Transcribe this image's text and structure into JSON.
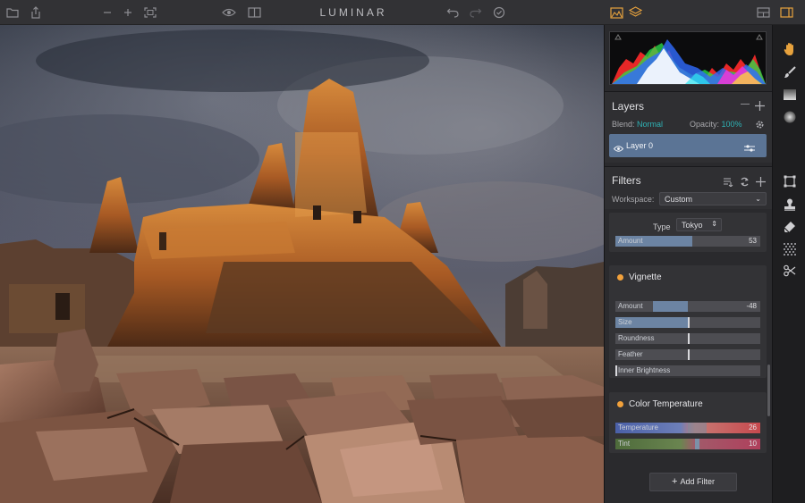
{
  "app": {
    "title": "LUMINAR"
  },
  "toolbar": {
    "icons": [
      "folder-icon",
      "share-icon",
      "zoom-out-icon",
      "zoom-in-icon",
      "fit-screen-icon",
      "preview-eye-icon",
      "compare-icon",
      "undo-icon",
      "redo-icon",
      "apply-check-icon",
      "histogram-toggle-icon",
      "layers-toggle-icon",
      "layout-icon",
      "side-panel-icon"
    ]
  },
  "histogram": {
    "colors": [
      "#ff2a2a",
      "#29e04a",
      "#2f6bff",
      "#ffffff",
      "#ff31d5",
      "#ffe62b",
      "#2ce6f0"
    ]
  },
  "layers": {
    "title": "Layers",
    "blend_label": "Blend:",
    "blend_value": "Normal",
    "opacity_label": "Opacity:",
    "opacity_value": "100%",
    "items": [
      {
        "name": "Layer 0"
      }
    ]
  },
  "filters": {
    "title": "Filters",
    "workspace_label": "Workspace:",
    "workspace_value": "Custom",
    "add_filter_label": "Add Filter",
    "partial": {
      "type_label": "Type",
      "type_value": "Tokyo",
      "amount": {
        "label": "Amount",
        "value": 53,
        "display": "53"
      }
    },
    "vignette": {
      "name": "Vignette",
      "sliders": [
        {
          "label": "Amount",
          "display": "-48",
          "value": -48,
          "fill_start": 0.26,
          "fill_end": 0.5
        },
        {
          "label": "Size",
          "display": "",
          "value": 50,
          "fill_start": 0,
          "fill_end": 0.5
        },
        {
          "label": "Roundness",
          "display": "",
          "value": 0,
          "fill_start": 0.5,
          "fill_end": 0.5
        },
        {
          "label": "Feather",
          "display": "",
          "value": 0,
          "fill_start": 0.5,
          "fill_end": 0.5
        },
        {
          "label": "Inner Brightness",
          "display": "",
          "value": 0,
          "fill_start": 0,
          "fill_end": 0
        }
      ]
    },
    "color_temperature": {
      "name": "Color Temperature",
      "temperature": {
        "label": "Temperature",
        "value": 26,
        "display": "26"
      },
      "tint": {
        "label": "Tint",
        "value": 10,
        "display": "10"
      }
    }
  },
  "side_tools": [
    "hand-icon",
    "brush-icon",
    "gradient-icon",
    "radial-icon",
    "crop-icon",
    "stamp-icon",
    "eraser-icon",
    "noise-icon",
    "scissors-icon"
  ],
  "colors": {
    "accent": "#2fb3b6",
    "selected_layer": "#5b7495",
    "filter_dot": "#f2a13b",
    "slider_fill": "#6c84a3"
  }
}
